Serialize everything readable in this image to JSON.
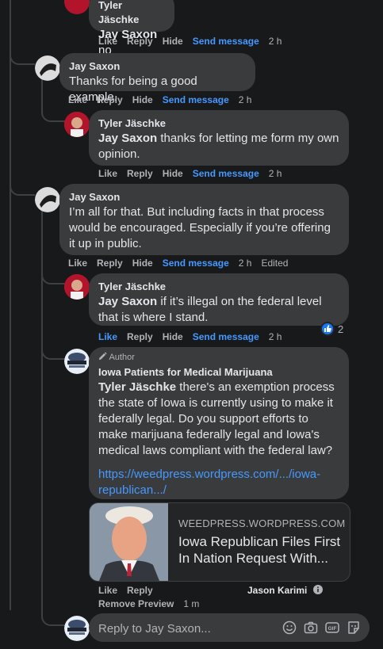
{
  "comments": [
    {
      "author": "Tyler Jäschke",
      "mention": "Jay Saxon",
      "text": " no",
      "time": "2 h"
    },
    {
      "author": "Jay Saxon",
      "mention": "",
      "text": "Thanks for being a good example.",
      "time": "2 h"
    },
    {
      "author": "Tyler Jäschke",
      "mention": "Jay Saxon",
      "text": " thanks for letting me form my own opinion.",
      "time": "2 h"
    },
    {
      "author": "Jay Saxon",
      "mention": "",
      "text": "I’m all for that. But including facts in that process would be encouraged. Especially if you’re offering it up in public.",
      "time": "2 h",
      "edited": "Edited"
    },
    {
      "author": "Tyler Jäschke",
      "mention": "Jay Saxon",
      "text": " if it’s illegal on the federal level that is where I stand.",
      "time": "2 h",
      "reaction_count": "2"
    },
    {
      "author": "Iowa Patients for Medical Marijuana",
      "badge": "Author",
      "mention": "Tyler Jäschke",
      "text": " there's an exemption process the state of Iowa is currently using to make it federally legal. Do you support efforts to make marijuana federally legal and Iowa's medical laws compliant with the federal law?",
      "link": "https://weedpress.wordpress.com/.../iowa-republican.../",
      "time": "1 m",
      "remove_preview": "Remove Preview",
      "tagged_user": "Jason Karimi"
    }
  ],
  "actions": {
    "like": "Like",
    "reply": "Reply",
    "hide": "Hide",
    "send": "Send message"
  },
  "preview": {
    "domain": "WEEDPRESS.WORDPRESS.COM",
    "title": "Iowa Republican Files First In Nation Request With..."
  },
  "reply_box": {
    "placeholder": "Reply to Jay Saxon..."
  },
  "colors": {
    "background": "#18191a",
    "bubble": "#3a3b3c",
    "link": "#4599ff",
    "muted": "#b0b3b8"
  }
}
